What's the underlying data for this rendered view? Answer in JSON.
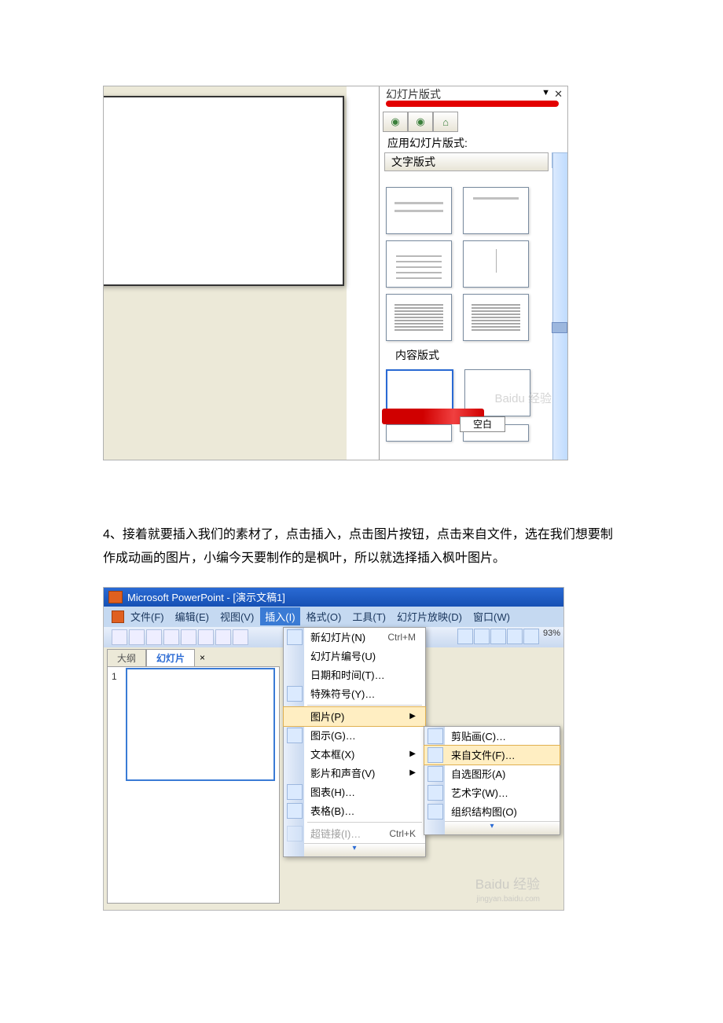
{
  "shot1": {
    "title": "幻灯片版式",
    "apply": "应用幻灯片版式:",
    "section1": "文字版式",
    "section2": "内容版式",
    "tag": "空白",
    "nav_back": "◉",
    "nav_fwd": "◉",
    "nav_home": "⌂",
    "drop": "▼",
    "close": "✕",
    "sb_up": "˄"
  },
  "para": "4、接着就要插入我们的素材了，点击插入，点击图片按钮，点击来自文件，选在我们想要制作成动画的图片，小编今天要制作的是枫叶，所以就选择插入枫叶图片。",
  "shot2": {
    "title": "Microsoft PowerPoint - [演示文稿1]",
    "menu": {
      "file": "文件(F)",
      "edit": "编辑(E)",
      "view": "视图(V)",
      "insert": "插入(I)",
      "format": "格式(O)",
      "tools": "工具(T)",
      "slideshow": "幻灯片放映(D)",
      "window": "窗口(W)"
    },
    "tabs": {
      "outline": "大纲",
      "slides": "幻灯片",
      "close": "×"
    },
    "slidenum": "1",
    "zoom": "93%",
    "insertmenu": {
      "newslide": "新幻灯片(N)",
      "newslide_sc": "Ctrl+M",
      "slidenum": "幻灯片编号(U)",
      "datetime": "日期和时间(T)…",
      "symbol": "特殊符号(Y)…",
      "picture": "图片(P)",
      "diagram": "图示(G)…",
      "textbox": "文本框(X)",
      "movie": "影片和声音(V)",
      "chart": "图表(H)…",
      "table": "表格(B)…",
      "hyperlink": "超链接(I)…",
      "hyperlink_sc": "Ctrl+K",
      "arrow": "▶",
      "expand": "▾"
    },
    "picmenu": {
      "clipart": "剪贴画(C)…",
      "fromfile": "来自文件(F)…",
      "autoshapes": "自选图形(A)",
      "wordart": "艺术字(W)…",
      "orgchart": "组织结构图(O)",
      "expand": "▾"
    },
    "watermark": "Baidu 经验"
  }
}
